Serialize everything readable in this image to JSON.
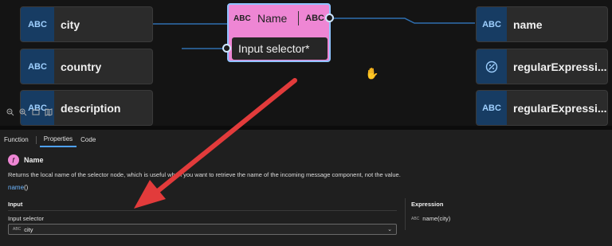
{
  "canvas": {
    "source_nodes": [
      {
        "type": "ABC",
        "label": "city"
      },
      {
        "type": "ABC",
        "label": "country"
      },
      {
        "type": "ABC",
        "label": "description"
      }
    ],
    "function_node": {
      "icon": "ABC",
      "name": "Name",
      "return_type": "ABC",
      "input_label": "Input selector*"
    },
    "target_nodes": [
      {
        "type": "ABC",
        "label": "name"
      },
      {
        "type": "regex-icon",
        "label": "regularExpressi..."
      },
      {
        "type": "ABC",
        "label": "regularExpressi..."
      }
    ]
  },
  "panel": {
    "tabs": [
      "Function",
      "Properties",
      "Code"
    ],
    "active_tab": "Properties",
    "function_title": "Name",
    "description": "Returns the local name of the selector node, which is useful when you want to retrieve the name of the incoming message component, not the value.",
    "signature_name": "name",
    "signature_parens": "()",
    "input_heading": "Input",
    "input_selector_label": "Input selector",
    "input_selector_type": "ABC",
    "input_selector_value": "city",
    "expression_heading": "Expression",
    "expression_type": "ABC",
    "expression_value": "name(city)"
  },
  "colors": {
    "function_node": "#ee86d4",
    "type_tag": "#173c63",
    "accent": "#4ea1ff",
    "arrow": "#e23b3b"
  }
}
